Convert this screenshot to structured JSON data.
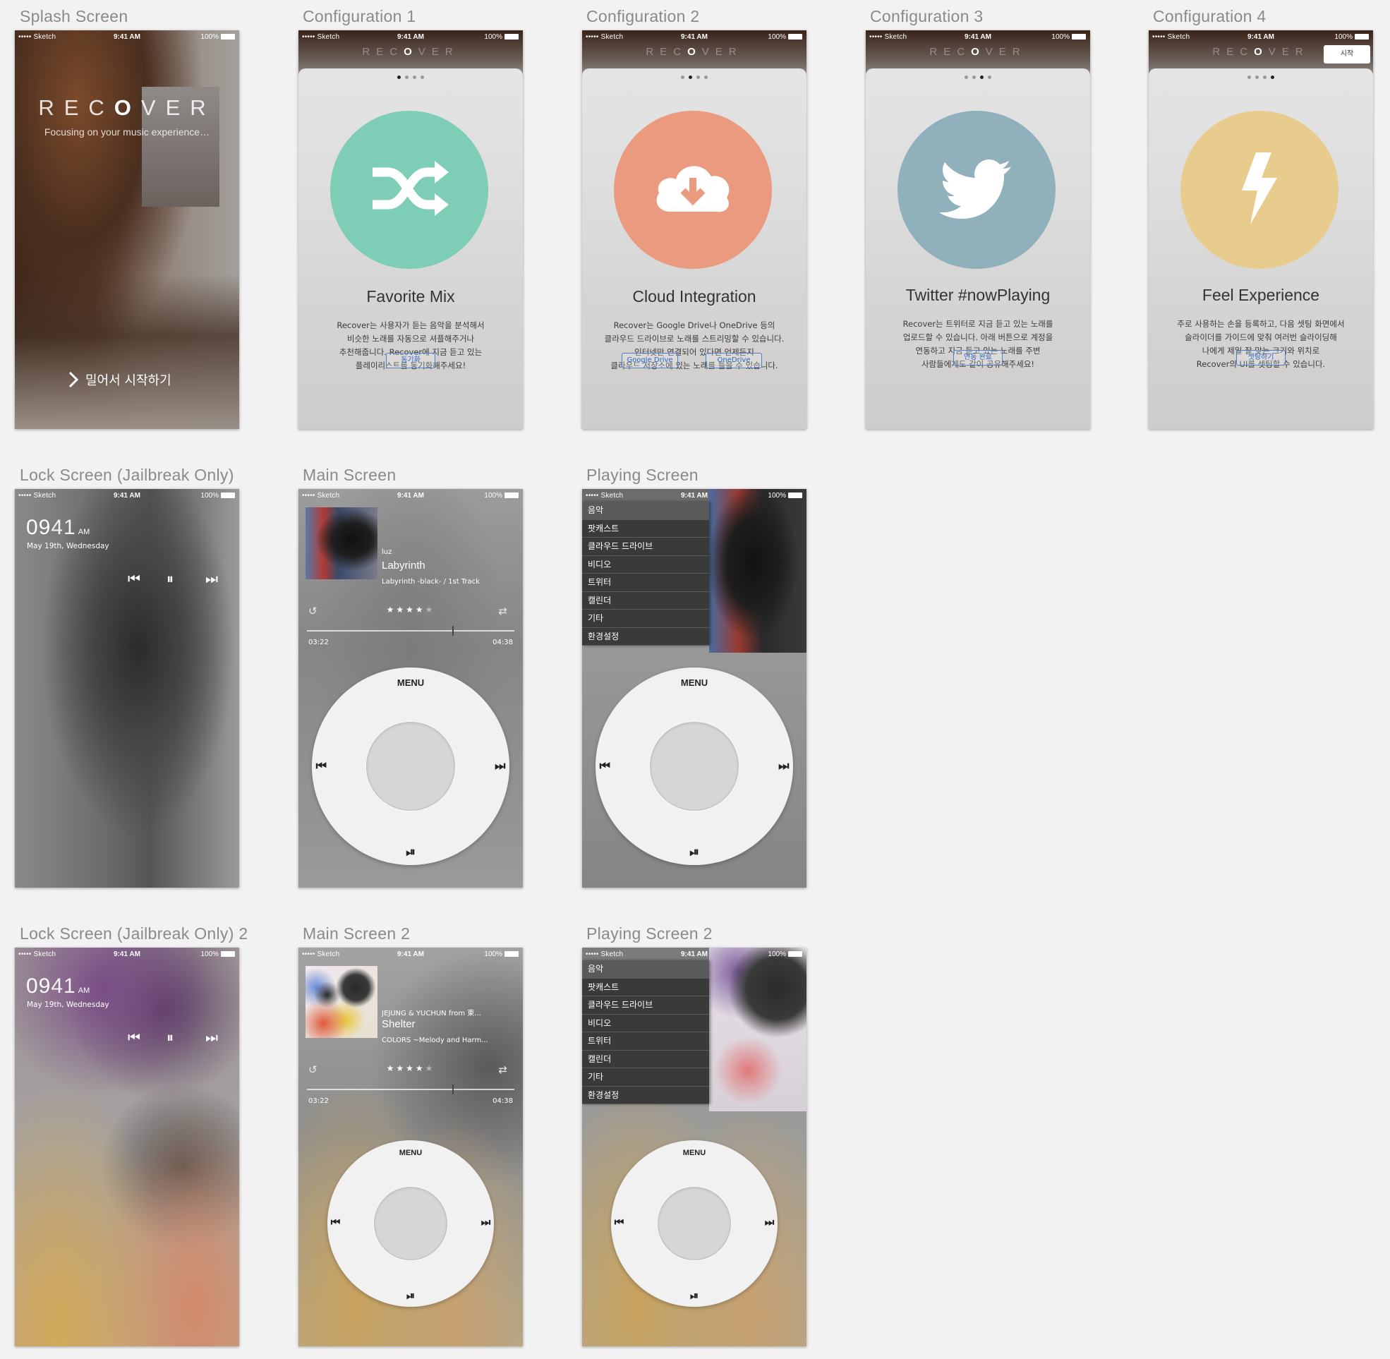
{
  "labels": {
    "splash": "Splash Screen",
    "cfg1": "Configuration 1",
    "cfg2": "Configuration 2",
    "cfg3": "Configuration 3",
    "cfg4": "Configuration 4",
    "lock1": "Lock Screen (Jailbreak Only)",
    "main1": "Main Screen",
    "play1": "Playing Screen",
    "lock2": "Lock Screen (Jailbreak Only) 2",
    "main2": "Main Screen 2",
    "play2": "Playing Screen 2"
  },
  "status": {
    "carrier": "••••• Sketch",
    "time": "9:41 AM",
    "battery": "100%"
  },
  "logo": {
    "prefix": "REC",
    "o": "O",
    "suffix": "VER"
  },
  "splash": {
    "tagline": "Focusing on your music experience…",
    "swipe": "밀어서 시작하기"
  },
  "cfg": [
    {
      "title": "Favorite Mix",
      "lines": [
        "Recover는 사용자가 듣는 음악을 분석해서",
        "비슷한 노래를 자동으로 셔플해주거나",
        "추천해줍니다. Recover에 지금 듣고 있는",
        "플레이리스트를 동기화해주세요!"
      ],
      "buttons": [
        "동기화"
      ],
      "color": "#7ecdb6",
      "icon": "shuffle-icon"
    },
    {
      "title": "Cloud Integration",
      "lines": [
        "Recover는 Google Drive나 OneDrive 등의",
        "클라우드 드라이브로 노래를 스트리밍할 수 있습니다.",
        "인터넷만 연결되어 있다면 언제든지",
        "클라우드 저장소에 있는 노래를 들을 수 있습니다."
      ],
      "buttons": [
        "Google Drive",
        "OneDrive"
      ],
      "color": "#ea9a7e",
      "icon": "cloud-download-icon"
    },
    {
      "title": "Twitter #nowPlaying",
      "lines": [
        "Recover는 트위터로 지금 듣고 있는 노래를",
        "업로드할 수 있습니다. 아래 버튼으로 계정을",
        "연동하고 지금 듣고 있는 노래를 주변",
        "사람들에게도 같이 공유해주세요!"
      ],
      "buttons": [
        "연동 완료"
      ],
      "color": "#90b0bc",
      "icon": "twitter-bird-icon"
    },
    {
      "title": "Feel Experience",
      "lines": [
        "주로 사용하는 손을 등록하고, 다음 셋팅 화면에서",
        "슬라이더를 가이드에 맞춰 여러번 슬라이딩해",
        "나에게 제일 잘 맞는 크기와 위치로",
        "Recover의 UI를 셋팅할 수 있습니다."
      ],
      "buttons": [
        "셋팅하기"
      ],
      "color": "#e8cc8e",
      "icon": "lightning-icon",
      "top_button": "시작"
    }
  ],
  "lock": {
    "hour": "09",
    "minute": "41",
    "ampm": "AM",
    "date": "May 19th, Wednesday"
  },
  "main1": {
    "artist": "luz",
    "song": "Labyrinth",
    "album": "Labyrinth -black- / 1st Track",
    "elapsed": "03:22",
    "total": "04:38",
    "rating": 4,
    "progress": 0.7
  },
  "main2": {
    "artist": "JEJUNG & YUCHUN from 東...",
    "song": "Shelter",
    "album": "COLORS ~Melody and Harm...",
    "elapsed": "03:22",
    "total": "04:38",
    "rating": 4,
    "progress": 0.7
  },
  "wheel": {
    "menu": "MENU"
  },
  "menu_items": [
    "음악",
    "팟캐스트",
    "클라우드 드라이브",
    "비디오",
    "트위터",
    "캘린더",
    "기타",
    "환경설정"
  ]
}
